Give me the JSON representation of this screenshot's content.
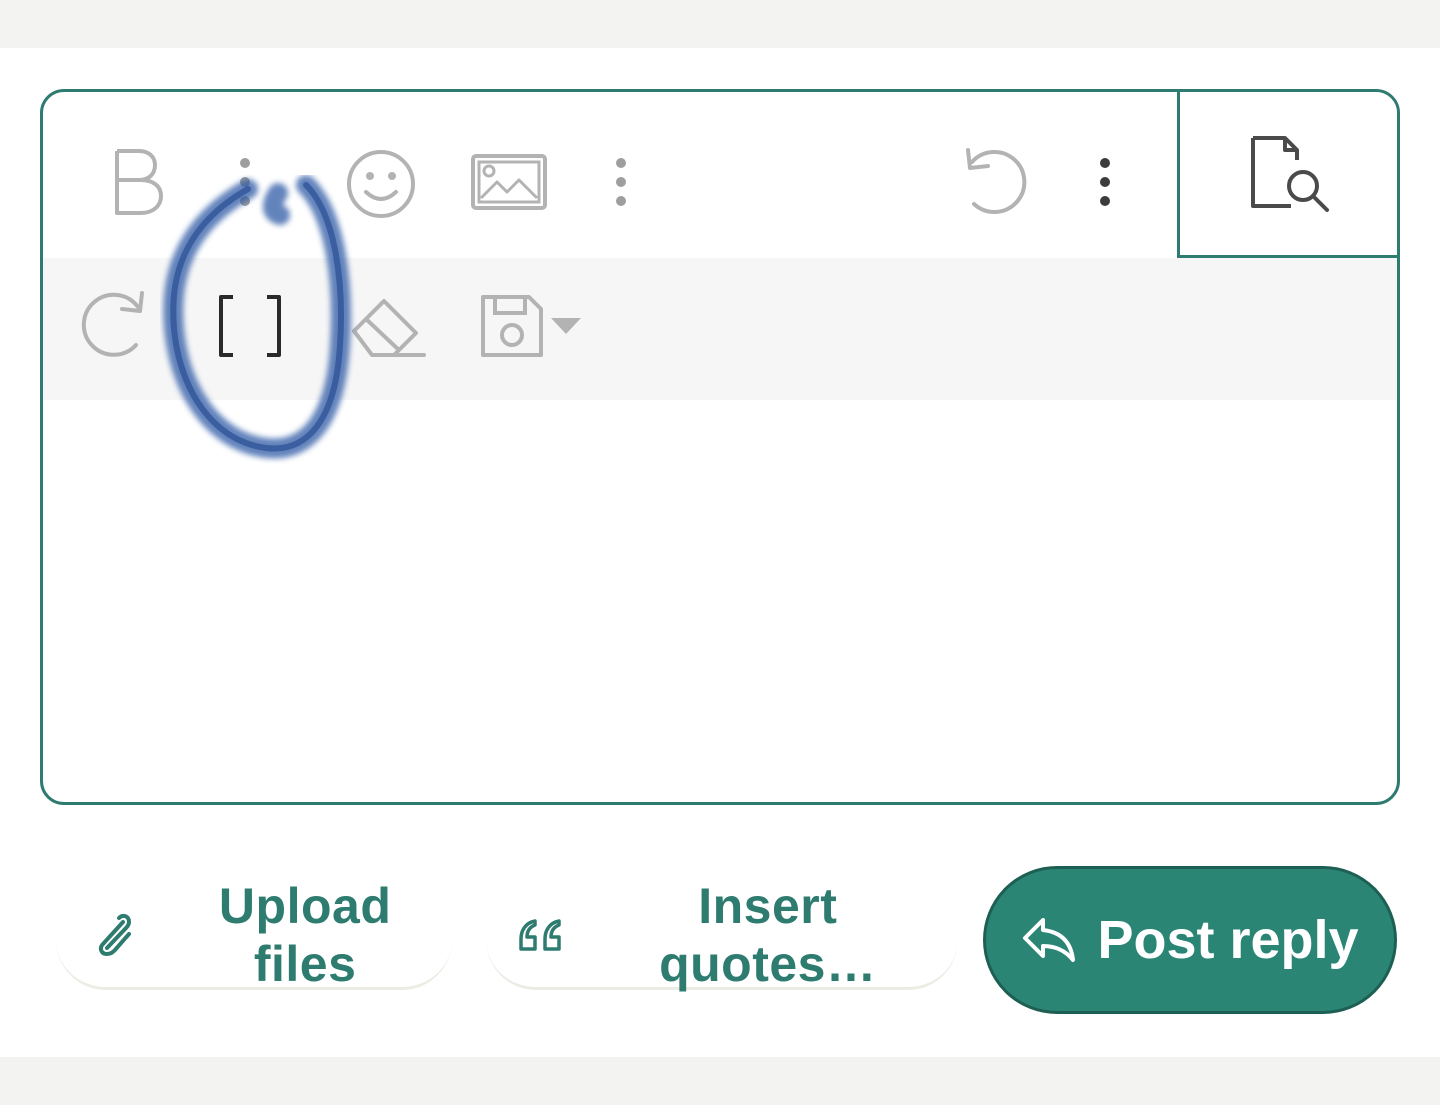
{
  "editor": {
    "toolbar_row1": [
      {
        "name": "bold",
        "icon": "bold-icon"
      },
      {
        "name": "more-text",
        "icon": "vertical-ellipsis-icon"
      },
      {
        "name": "emoji",
        "icon": "smiley-icon"
      },
      {
        "name": "image",
        "icon": "image-icon"
      },
      {
        "name": "more-insert",
        "icon": "vertical-ellipsis-icon"
      },
      {
        "name": "undo",
        "icon": "undo-icon"
      },
      {
        "name": "more-options",
        "icon": "vertical-ellipsis-icon"
      },
      {
        "name": "preview",
        "icon": "document-search-icon"
      }
    ],
    "toolbar_row2": [
      {
        "name": "redo",
        "icon": "redo-icon"
      },
      {
        "name": "bbcode-toggle",
        "icon": "square-brackets-icon"
      },
      {
        "name": "remove-formatting",
        "icon": "eraser-icon"
      },
      {
        "name": "drafts",
        "icon": "floppy-disk-icon"
      }
    ],
    "textarea_value": ""
  },
  "actions": {
    "upload_label": "Upload files",
    "quotes_label": "Insert quotes…",
    "post_label": "Post reply"
  },
  "colors": {
    "accent": "#2e7b70",
    "post_button": "#2a8574",
    "toolbar_icon": "#b3b3b3",
    "annotation": "#1f4a94"
  }
}
